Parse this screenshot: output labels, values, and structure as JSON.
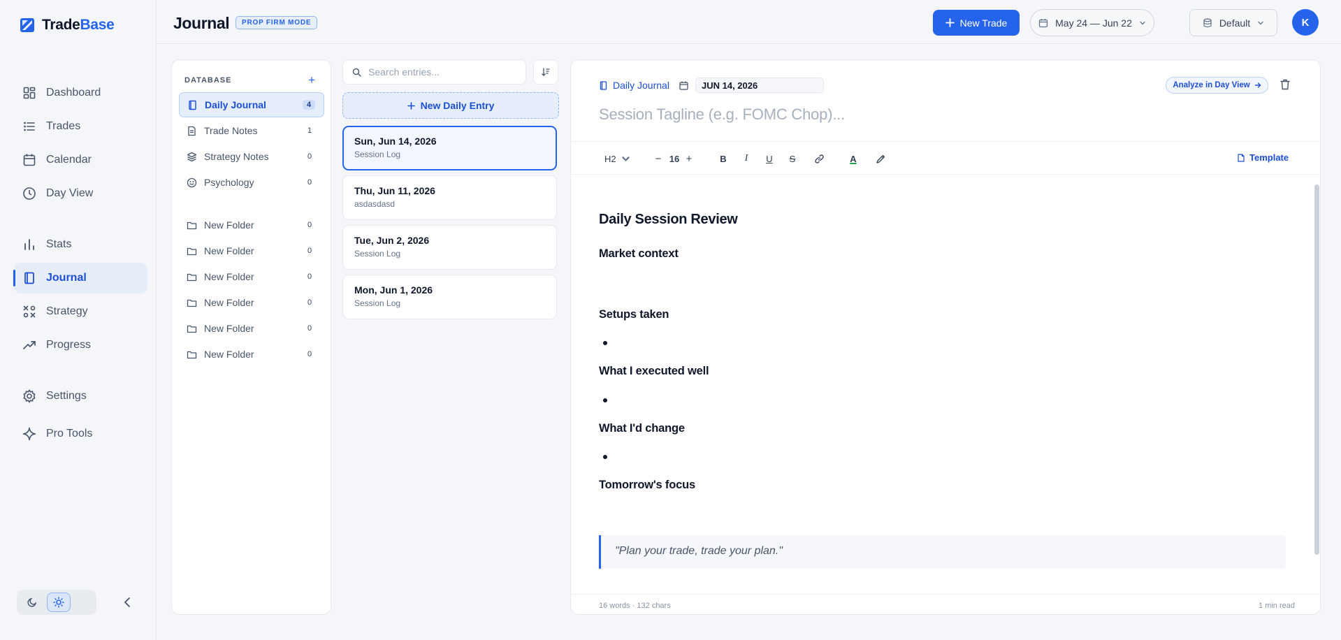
{
  "brand": {
    "name_part1": "Trade",
    "name_part2": "Base"
  },
  "sidebar": {
    "items": [
      {
        "label": "Dashboard",
        "icon": "dashboard-icon"
      },
      {
        "label": "Trades",
        "icon": "list-icon"
      },
      {
        "label": "Calendar",
        "icon": "calendar-icon"
      },
      {
        "label": "Day View",
        "icon": "clock-icon"
      },
      {
        "label": "Stats",
        "icon": "bar-chart-icon"
      },
      {
        "label": "Journal",
        "icon": "book-icon",
        "active": true
      },
      {
        "label": "Strategy",
        "icon": "strategy-icon"
      },
      {
        "label": "Progress",
        "icon": "trending-up-icon"
      },
      {
        "label": "Settings",
        "icon": "gear-icon"
      },
      {
        "label": "Pro Tools",
        "icon": "sparkle-icon"
      }
    ]
  },
  "header": {
    "title": "Journal",
    "mode_badge": "PROP FIRM MODE",
    "new_trade_label": "New Trade",
    "date_range": "May 24 — Jun 22",
    "profile": "Default",
    "avatar_initial": "K"
  },
  "database": {
    "header": "DATABASE",
    "items": [
      {
        "label": "Daily Journal",
        "count": "4",
        "active": true
      },
      {
        "label": "Trade Notes",
        "count": "1"
      },
      {
        "label": "Strategy Notes",
        "count": "0"
      },
      {
        "label": "Psychology",
        "count": "0"
      }
    ],
    "folders": [
      {
        "label": "New Folder",
        "count": "0"
      },
      {
        "label": "New Folder",
        "count": "0"
      },
      {
        "label": "New Folder",
        "count": "0"
      },
      {
        "label": "New Folder",
        "count": "0"
      },
      {
        "label": "New Folder",
        "count": "0"
      },
      {
        "label": "New Folder",
        "count": "0"
      }
    ]
  },
  "entries": {
    "search_placeholder": "Search entries...",
    "new_entry_label": "New Daily Entry",
    "items": [
      {
        "title": "Sun, Jun 14, 2026",
        "subtitle": "Session Log",
        "active": true
      },
      {
        "title": "Thu, Jun 11, 2026",
        "subtitle": "asdasdasd"
      },
      {
        "title": "Tue, Jun 2, 2026",
        "subtitle": "Session Log"
      },
      {
        "title": "Mon, Jun 1, 2026",
        "subtitle": "Session Log"
      }
    ]
  },
  "editor": {
    "entry_type": "Daily Journal",
    "date": "JUN 14, 2026",
    "analyze_label": "Analyze in Day View",
    "tagline_placeholder": "Session Tagline (e.g. FOMC Chop)...",
    "toolbar": {
      "heading": "H2",
      "font_size": "16",
      "bold": "B",
      "italic": "I",
      "underline": "U",
      "strike": "S",
      "text_color": "A",
      "template_label": "Template"
    },
    "doc": {
      "title": "Daily Session Review",
      "sections": [
        "Market context",
        "Setups taken",
        "What I executed well",
        "What I'd change",
        "Tomorrow's focus"
      ],
      "quote": "\"Plan your trade, trade your plan.\""
    },
    "footer": {
      "stats": "16 words · 132 chars",
      "read_time": "1 min read"
    }
  },
  "colors": {
    "accent": "#2563eb",
    "background": "#f4f6f9",
    "panel": "#ffffff"
  }
}
